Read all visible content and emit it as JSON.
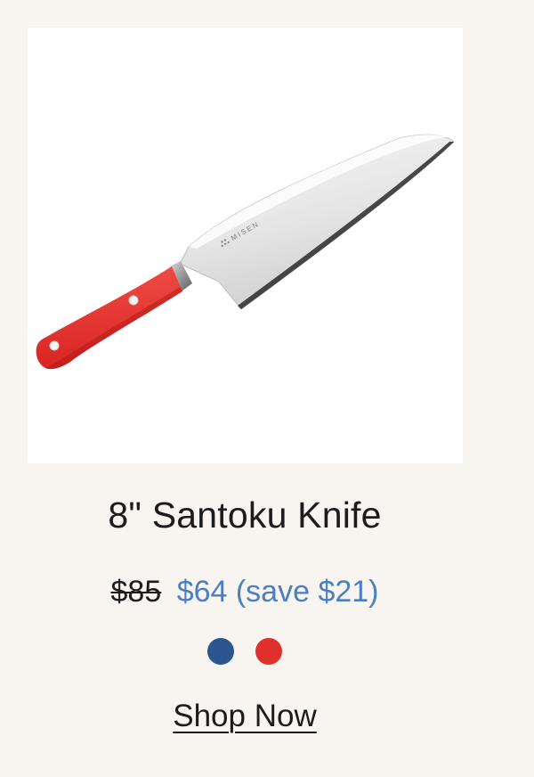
{
  "product": {
    "title": "8\" Santoku Knife",
    "price_original": "$85",
    "price_sale": "$64 (save $21)",
    "brand_mark": "MISEN",
    "image_icon": "santoku-knife-icon"
  },
  "swatches": [
    {
      "name": "blue",
      "color": "#2d5590"
    },
    {
      "name": "red",
      "color": "#e0302e"
    }
  ],
  "cta": {
    "label": "Shop Now"
  },
  "colors": {
    "background": "#f8f4f0",
    "sale_price": "#4b7fc0",
    "text": "#1c1c1c",
    "handle": "#e8312f"
  }
}
